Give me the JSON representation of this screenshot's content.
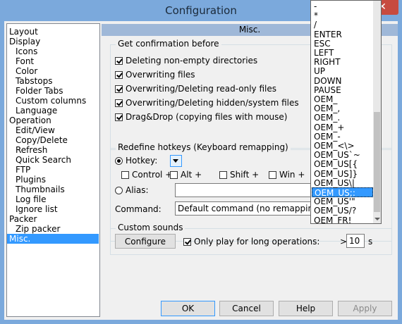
{
  "window": {
    "title": "Configuration",
    "close_glyph": "✕"
  },
  "tree": {
    "items": [
      {
        "label": "Layout",
        "level": 0
      },
      {
        "label": "Display",
        "level": 0
      },
      {
        "label": "Icons",
        "level": 1
      },
      {
        "label": "Font",
        "level": 1
      },
      {
        "label": "Color",
        "level": 1
      },
      {
        "label": "Tabstops",
        "level": 1
      },
      {
        "label": "Folder Tabs",
        "level": 1
      },
      {
        "label": "Custom columns",
        "level": 1
      },
      {
        "label": "Language",
        "level": 1
      },
      {
        "label": "Operation",
        "level": 0
      },
      {
        "label": "Edit/View",
        "level": 1
      },
      {
        "label": "Copy/Delete",
        "level": 1
      },
      {
        "label": "Refresh",
        "level": 1
      },
      {
        "label": "Quick Search",
        "level": 1
      },
      {
        "label": "FTP",
        "level": 1
      },
      {
        "label": "Plugins",
        "level": 1
      },
      {
        "label": "Thumbnails",
        "level": 1
      },
      {
        "label": "Log file",
        "level": 1
      },
      {
        "label": "Ignore list",
        "level": 1
      },
      {
        "label": "Packer",
        "level": 0
      },
      {
        "label": "Zip packer",
        "level": 1
      },
      {
        "label": "Misc.",
        "level": 0,
        "selected": true
      }
    ]
  },
  "section_header": "Misc.",
  "confirm": {
    "title": "Get confirmation before",
    "options": [
      {
        "label": "Deleting non-empty directories",
        "checked": true
      },
      {
        "label": "Overwriting files",
        "checked": true
      },
      {
        "label": "Overwriting/Deleting read-only files",
        "checked": true
      },
      {
        "label": "Overwriting/Deleting hidden/system files",
        "checked": true
      },
      {
        "label": "Drag&Drop (copying files with mouse)",
        "checked": true
      }
    ]
  },
  "hotkeys": {
    "title": "Redefine hotkeys (Keyboard remapping)",
    "hotkey_label": "Hotkey:",
    "control_label": "Control +",
    "alt_label": "Alt +",
    "shift_label": "Shift +",
    "win_label": "Win +",
    "alias_label": "Alias:",
    "command_label": "Command:",
    "command_value": "Default command (no remapping)"
  },
  "hotkey_dropdown": {
    "items": [
      "-",
      "*",
      "/",
      "ENTER",
      "ESC",
      "LEFT",
      "RIGHT",
      "UP",
      "DOWN",
      "PAUSE",
      "OEM_",
      "OEM_,",
      "OEM_.",
      "OEM_+",
      "OEM_-",
      "OEM_<\\>",
      "OEM_US`~",
      "OEM_US[{",
      "OEM_US]}",
      "OEM_US\\|",
      "OEM_US;:",
      "OEM_US'\"",
      "OEM_US/?",
      "OEM_FR!"
    ],
    "selected": "OEM_US;:"
  },
  "sounds": {
    "title": "Custom sounds",
    "configure_label": "Configure",
    "long_ops_label": "Only play for long operations:",
    "gt_label": ">",
    "seconds_value": "10",
    "seconds_unit": "s"
  },
  "buttons": {
    "ok": "OK",
    "cancel": "Cancel",
    "help": "Help",
    "apply": "Apply"
  }
}
